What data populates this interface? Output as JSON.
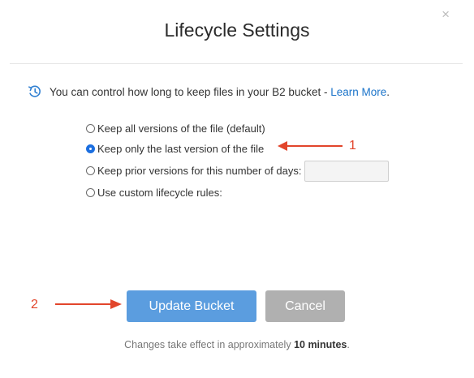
{
  "dialog": {
    "title": "Lifecycle Settings",
    "close_glyph": "×"
  },
  "intro": {
    "icon": "history-icon",
    "text": "You can control how long to keep files in your B2 bucket - ",
    "link_label": "Learn More",
    "trailing": "."
  },
  "options": [
    {
      "label": "Keep all versions of the file (default)",
      "checked": false
    },
    {
      "label": "Keep only the last version of the file",
      "checked": true
    },
    {
      "label": "Keep prior versions for this number of days:",
      "checked": false,
      "input_value": ""
    },
    {
      "label": "Use custom lifecycle rules:",
      "checked": false
    }
  ],
  "annotations": {
    "marker_1": "1",
    "marker_2": "2",
    "color": "#e2452b"
  },
  "buttons": {
    "update_label": "Update Bucket",
    "cancel_label": "Cancel",
    "primary_color": "#5b9ddf",
    "cancel_color": "#b0b0b0"
  },
  "footnote": {
    "prefix": "Changes take effect in approximately ",
    "emphasis": "10 minutes",
    "suffix": "."
  }
}
